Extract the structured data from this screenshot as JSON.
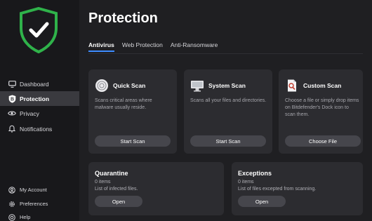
{
  "sidebar": {
    "items": [
      {
        "label": "Dashboard",
        "icon": "monitor-icon"
      },
      {
        "label": "Protection",
        "icon": "b-shield-icon",
        "active": true
      },
      {
        "label": "Privacy",
        "icon": "eye-icon"
      },
      {
        "label": "Notifications",
        "icon": "bell-icon"
      }
    ],
    "bottom_items": [
      {
        "label": "My Account",
        "icon": "user-icon"
      },
      {
        "label": "Preferences",
        "icon": "gear-icon"
      },
      {
        "label": "Help",
        "icon": "help-icon"
      }
    ]
  },
  "main": {
    "title": "Protection",
    "tabs": [
      {
        "label": "Antivirus",
        "active": true
      },
      {
        "label": "Web Protection"
      },
      {
        "label": "Anti-Ransomware"
      }
    ],
    "scan_cards": [
      {
        "title": "Quick Scan",
        "desc": "Scans critical areas where malware usually reside.",
        "button": "Start Scan",
        "icon": "quick-scan-icon"
      },
      {
        "title": "System Scan",
        "desc": "Scans all your files and directories.",
        "button": "Start Scan",
        "icon": "monitor-icon"
      },
      {
        "title": "Custom Scan",
        "desc": "Choose a file or simply drop items on Bitdefender's Dock icon to scan them.",
        "button": "Choose File",
        "icon": "custom-scan-icon"
      }
    ],
    "bottom_cards": [
      {
        "title": "Quarantine",
        "count": "0 items",
        "desc": "List of infected files.",
        "button": "Open"
      },
      {
        "title": "Exceptions",
        "count": "0 items",
        "desc": "List of files excepted from scanning.",
        "button": "Open"
      }
    ]
  },
  "colors": {
    "accent_green": "#2fb24a",
    "accent_blue": "#3d8cff"
  }
}
